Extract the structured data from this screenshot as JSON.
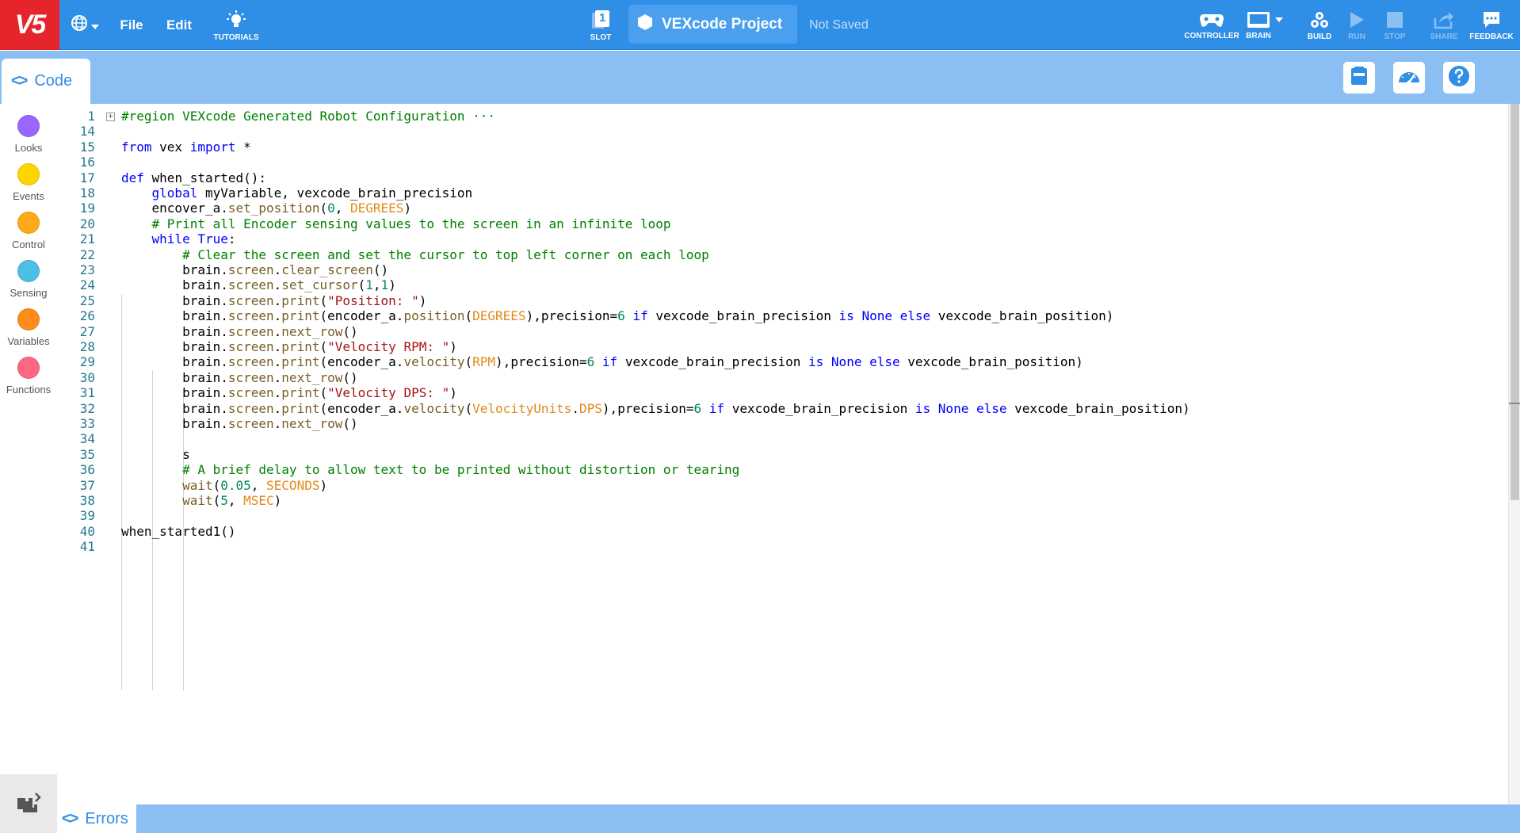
{
  "app": {
    "logo": "V5"
  },
  "topbar": {
    "file_label": "File",
    "edit_label": "Edit",
    "tutorials_label": "TUTORIALS",
    "slot_label": "SLOT",
    "slot_number": "1",
    "project_name": "VEXcode Project",
    "save_status": "Not Saved",
    "controller_label": "CONTROLLER",
    "brain_label": "BRAIN",
    "build_label": "BUILD",
    "run_label": "RUN",
    "stop_label": "STOP",
    "share_label": "SHARE",
    "feedback_label": "FEEDBACK"
  },
  "tabs": {
    "code_label": "Code",
    "errors_label": "Errors"
  },
  "categories": [
    {
      "label": "Looks",
      "color": "#9966ff"
    },
    {
      "label": "Events",
      "color": "#ffd500"
    },
    {
      "label": "Control",
      "color": "#ffab19"
    },
    {
      "label": "Sensing",
      "color": "#4cbfe6"
    },
    {
      "label": "Variables",
      "color": "#ff8c1a"
    },
    {
      "label": "Functions",
      "color": "#ff6680"
    }
  ],
  "colors": {
    "brand_red": "#e5242b",
    "topbar_blue": "#2f8ee5",
    "tabbar_blue": "#8bbef2"
  },
  "editor": {
    "lines": [
      {
        "n": "1",
        "text": "#region VEXcode Generated Robot Configuration ···"
      },
      {
        "n": "14",
        "text": ""
      },
      {
        "n": "15",
        "text": "from vex import *"
      },
      {
        "n": "16",
        "text": ""
      },
      {
        "n": "17",
        "text": "def when_started():"
      },
      {
        "n": "18",
        "text": "    global myVariable, vexcode_brain_precision"
      },
      {
        "n": "19",
        "text": "    encover_a.set_position(0, DEGREES)"
      },
      {
        "n": "20",
        "text": "    # Print all Encoder sensing values to the screen in an infinite loop"
      },
      {
        "n": "21",
        "text": "    while True:"
      },
      {
        "n": "22",
        "text": "        # Clear the screen and set the cursor to top left corner on each loop"
      },
      {
        "n": "23",
        "text": "        brain.screen.clear_screen()"
      },
      {
        "n": "24",
        "text": "        brain.screen.set_cursor(1,1)"
      },
      {
        "n": "25",
        "text": "        brain.screen.print(\"Position: \")"
      },
      {
        "n": "26",
        "text": "        brain.screen.print(encoder_a.position(DEGREES),precision=6 if vexcode_brain_precision is None else vexcode_brain_position)"
      },
      {
        "n": "27",
        "text": "        brain.screen.next_row()"
      },
      {
        "n": "28",
        "text": "        brain.screen.print(\"Velocity RPM: \")"
      },
      {
        "n": "29",
        "text": "        brain.screen.print(encoder_a.velocity(RPM),precision=6 if vexcode_brain_precision is None else vexcode_brain_position)"
      },
      {
        "n": "30",
        "text": "        brain.screen.next_row()"
      },
      {
        "n": "31",
        "text": "        brain.screen.print(\"Velocity DPS: \")"
      },
      {
        "n": "32",
        "text": "        brain.screen.print(encoder_a.velocity(VelocityUnits.DPS),precision=6 if vexcode_brain_precision is None else vexcode_brain_position)"
      },
      {
        "n": "33",
        "text": "        brain.screen.next_row()"
      },
      {
        "n": "34",
        "text": ""
      },
      {
        "n": "35",
        "text": "        s"
      },
      {
        "n": "36",
        "text": "        # A brief delay to allow text to be printed without distortion or tearing"
      },
      {
        "n": "37",
        "text": "        wait(0.05, SECONDS)"
      },
      {
        "n": "38",
        "text": "        wait(5, MSEC)"
      },
      {
        "n": "39",
        "text": ""
      },
      {
        "n": "40",
        "text": "when_started1()"
      },
      {
        "n": "41",
        "text": ""
      }
    ]
  }
}
